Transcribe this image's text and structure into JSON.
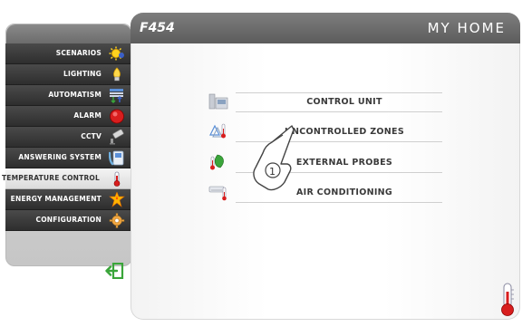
{
  "header": {
    "title": "F454",
    "brand": "MY HOME"
  },
  "sidebar": {
    "items": [
      {
        "label": "SCENARIOS",
        "icon": "scenarios-sun-icon"
      },
      {
        "label": "LIGHTING",
        "icon": "lightbulb-icon"
      },
      {
        "label": "AUTOMATISM",
        "icon": "automatism-icon"
      },
      {
        "label": "ALARM",
        "icon": "alarm-icon"
      },
      {
        "label": "CCTV",
        "icon": "camera-icon"
      },
      {
        "label": "ANSWERING SYSTEM",
        "icon": "phone-icon"
      },
      {
        "label": "TEMPERATURE CONTROL",
        "icon": "thermometer-icon",
        "active": true
      },
      {
        "label": "ENERGY MANAGEMENT",
        "icon": "energy-icon"
      },
      {
        "label": "CONFIGURATION",
        "icon": "gear-icon"
      }
    ],
    "back_icon": "back-arrow-icon"
  },
  "main": {
    "options": [
      {
        "label": "CONTROL UNIT",
        "icon": "control-unit-icon"
      },
      {
        "label": "UNCONTROLLED ZONES",
        "icon": "uncontrolled-zones-icon"
      },
      {
        "label": "EXTERNAL PROBES",
        "icon": "external-probes-icon"
      },
      {
        "label": "AIR CONDITIONING",
        "icon": "air-conditioning-icon"
      }
    ],
    "callout_number": "1",
    "corner_icon": "thermometer-icon"
  },
  "colors": {
    "menu_bg": "#3b3b3b",
    "active_bg": "#e8e8e8",
    "header_bg": "#6e6e6e",
    "accent_green": "#3aa53a",
    "alarm_red": "#d81e1e"
  }
}
